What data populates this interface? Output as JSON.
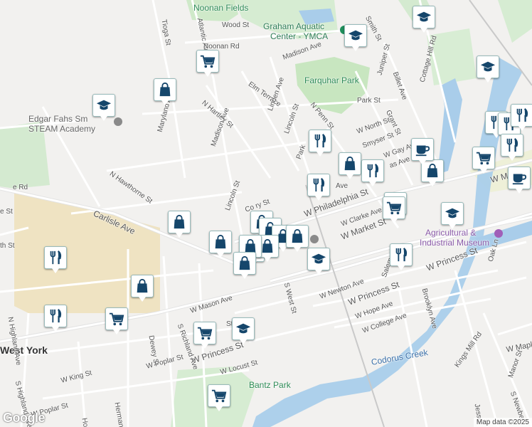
{
  "map": {
    "labels": {
      "noonan_fields": "Noonan Fields",
      "graham_aquatic": "Graham Aquatic",
      "center_ymca": "Center - YMCA",
      "farquhar_park": "Farquhar Park",
      "edgar_fahs": "Edgar Fahs Sm",
      "steam_academy": "STEAM Academy",
      "agricultural": "Agricultural &",
      "industrial_museum": "Industrial Museum",
      "west_york": "West York",
      "bantz_park": "Bantz Park",
      "codorus_creek": "Codorus Creek"
    },
    "streets": {
      "tioga": "Tioga St",
      "atlantic": "Atlantic Ave",
      "wood": "Wood St",
      "noonan": "Noonan Rd",
      "madison_ave_top": "Madison Ave",
      "smith": "Smith St",
      "elm_terrace": "Elm Terrace",
      "linden": "Linden Ave",
      "n_penn": "N Penn St",
      "park_st": "Park St",
      "grant": "Grant St",
      "juniper": "Juniper St",
      "billet": "Billet Ave",
      "cottage_hill": "Cottage Hill Rd",
      "n_hartley": "N Hartley St",
      "maryland": "Maryland Ave",
      "madison_ave": "Madison Ave",
      "lincoln_st_upper": "Lincoln St",
      "w_north": "W North St",
      "smyser": "Smyser St",
      "park_short": "Park",
      "w_gay": "W Gay Ave",
      "w_jackson": "as Ave",
      "n_hawthorne": "N Hawthorne St",
      "lincoln_st_lower": "Lincoln St",
      "carlisle": "Carlisle Ave",
      "w_philadelphia": "W Philadelphia St",
      "w_clarke": "W Clarke Ave",
      "w_market": "W Market St",
      "w_market_right": "W M",
      "s_west": "S West St",
      "w_newton": "W Newton Ave",
      "salem": "Salem",
      "w_princess_mid": "W Princess St",
      "w_princess_right": "W Princess St",
      "w_princess_low": "W Princess St",
      "w_hope": "W Hope Ave",
      "w_college": "W College Ave",
      "brooklyn": "Brooklyn Ave",
      "oak_ln": "Oak Ln",
      "kings_mill": "Kings Mill Rd",
      "w_maple": "W Maple",
      "manor": "Manor St",
      "s_newberry": "S Newber",
      "jessop": "Jesso",
      "w_mason": "W Mason Ave",
      "s_richland": "S Richland Ave",
      "dewey": "Dewey St",
      "w_poplar_upper": "W Poplar St",
      "w_locust": "W Locust St",
      "w_king": "W King St",
      "w_poplar_lower": "W Poplar St",
      "herman": "Herman St",
      "hoke": "Hoke",
      "n_highland": "N Highland Ave",
      "s_highland": "S Highland Ave",
      "rd_left": "e Rd",
      "st_left1": "e St",
      "st_left2": "th St",
      "cor_st": "Co  ry St",
      "st_short": "St",
      "ave_short": "Ave"
    },
    "markers": [
      {
        "type": "school"
      },
      {
        "type": "school"
      },
      {
        "type": "school"
      },
      {
        "type": "school"
      },
      {
        "type": "school"
      },
      {
        "type": "school"
      },
      {
        "type": "school"
      },
      {
        "type": "school"
      },
      {
        "type": "shop"
      },
      {
        "type": "shop"
      },
      {
        "type": "shop"
      },
      {
        "type": "shop"
      },
      {
        "type": "shop"
      },
      {
        "type": "shop"
      },
      {
        "type": "shop"
      },
      {
        "type": "shop"
      },
      {
        "type": "shop"
      },
      {
        "type": "shop"
      },
      {
        "type": "shop"
      },
      {
        "type": "shop"
      },
      {
        "type": "shop"
      },
      {
        "type": "cart"
      },
      {
        "type": "cart"
      },
      {
        "type": "cart"
      },
      {
        "type": "cart"
      },
      {
        "type": "cart"
      },
      {
        "type": "cart"
      },
      {
        "type": "cart"
      },
      {
        "type": "food"
      },
      {
        "type": "food"
      },
      {
        "type": "food"
      },
      {
        "type": "food"
      },
      {
        "type": "food"
      },
      {
        "type": "food"
      },
      {
        "type": "food"
      },
      {
        "type": "food"
      },
      {
        "type": "food"
      },
      {
        "type": "food"
      },
      {
        "type": "cafe"
      },
      {
        "type": "cafe"
      }
    ],
    "google_logo": "Google",
    "attribution": "Map data ©2025"
  }
}
